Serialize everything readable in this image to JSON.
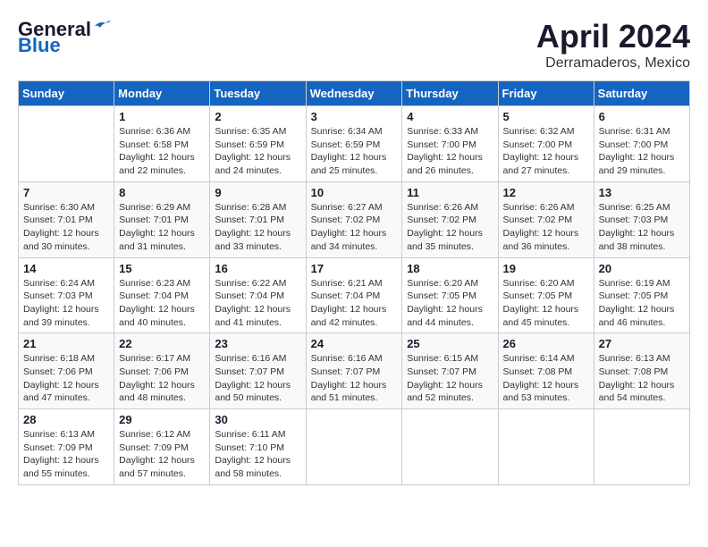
{
  "header": {
    "logo_line1": "General",
    "logo_line2": "Blue",
    "title": "April 2024",
    "subtitle": "Derramaderos, Mexico"
  },
  "calendar": {
    "days_of_week": [
      "Sunday",
      "Monday",
      "Tuesday",
      "Wednesday",
      "Thursday",
      "Friday",
      "Saturday"
    ],
    "weeks": [
      [
        {
          "day": "",
          "info": ""
        },
        {
          "day": "1",
          "info": "Sunrise: 6:36 AM\nSunset: 6:58 PM\nDaylight: 12 hours\nand 22 minutes."
        },
        {
          "day": "2",
          "info": "Sunrise: 6:35 AM\nSunset: 6:59 PM\nDaylight: 12 hours\nand 24 minutes."
        },
        {
          "day": "3",
          "info": "Sunrise: 6:34 AM\nSunset: 6:59 PM\nDaylight: 12 hours\nand 25 minutes."
        },
        {
          "day": "4",
          "info": "Sunrise: 6:33 AM\nSunset: 7:00 PM\nDaylight: 12 hours\nand 26 minutes."
        },
        {
          "day": "5",
          "info": "Sunrise: 6:32 AM\nSunset: 7:00 PM\nDaylight: 12 hours\nand 27 minutes."
        },
        {
          "day": "6",
          "info": "Sunrise: 6:31 AM\nSunset: 7:00 PM\nDaylight: 12 hours\nand 29 minutes."
        }
      ],
      [
        {
          "day": "7",
          "info": "Sunrise: 6:30 AM\nSunset: 7:01 PM\nDaylight: 12 hours\nand 30 minutes."
        },
        {
          "day": "8",
          "info": "Sunrise: 6:29 AM\nSunset: 7:01 PM\nDaylight: 12 hours\nand 31 minutes."
        },
        {
          "day": "9",
          "info": "Sunrise: 6:28 AM\nSunset: 7:01 PM\nDaylight: 12 hours\nand 33 minutes."
        },
        {
          "day": "10",
          "info": "Sunrise: 6:27 AM\nSunset: 7:02 PM\nDaylight: 12 hours\nand 34 minutes."
        },
        {
          "day": "11",
          "info": "Sunrise: 6:26 AM\nSunset: 7:02 PM\nDaylight: 12 hours\nand 35 minutes."
        },
        {
          "day": "12",
          "info": "Sunrise: 6:26 AM\nSunset: 7:02 PM\nDaylight: 12 hours\nand 36 minutes."
        },
        {
          "day": "13",
          "info": "Sunrise: 6:25 AM\nSunset: 7:03 PM\nDaylight: 12 hours\nand 38 minutes."
        }
      ],
      [
        {
          "day": "14",
          "info": "Sunrise: 6:24 AM\nSunset: 7:03 PM\nDaylight: 12 hours\nand 39 minutes."
        },
        {
          "day": "15",
          "info": "Sunrise: 6:23 AM\nSunset: 7:04 PM\nDaylight: 12 hours\nand 40 minutes."
        },
        {
          "day": "16",
          "info": "Sunrise: 6:22 AM\nSunset: 7:04 PM\nDaylight: 12 hours\nand 41 minutes."
        },
        {
          "day": "17",
          "info": "Sunrise: 6:21 AM\nSunset: 7:04 PM\nDaylight: 12 hours\nand 42 minutes."
        },
        {
          "day": "18",
          "info": "Sunrise: 6:20 AM\nSunset: 7:05 PM\nDaylight: 12 hours\nand 44 minutes."
        },
        {
          "day": "19",
          "info": "Sunrise: 6:20 AM\nSunset: 7:05 PM\nDaylight: 12 hours\nand 45 minutes."
        },
        {
          "day": "20",
          "info": "Sunrise: 6:19 AM\nSunset: 7:05 PM\nDaylight: 12 hours\nand 46 minutes."
        }
      ],
      [
        {
          "day": "21",
          "info": "Sunrise: 6:18 AM\nSunset: 7:06 PM\nDaylight: 12 hours\nand 47 minutes."
        },
        {
          "day": "22",
          "info": "Sunrise: 6:17 AM\nSunset: 7:06 PM\nDaylight: 12 hours\nand 48 minutes."
        },
        {
          "day": "23",
          "info": "Sunrise: 6:16 AM\nSunset: 7:07 PM\nDaylight: 12 hours\nand 50 minutes."
        },
        {
          "day": "24",
          "info": "Sunrise: 6:16 AM\nSunset: 7:07 PM\nDaylight: 12 hours\nand 51 minutes."
        },
        {
          "day": "25",
          "info": "Sunrise: 6:15 AM\nSunset: 7:07 PM\nDaylight: 12 hours\nand 52 minutes."
        },
        {
          "day": "26",
          "info": "Sunrise: 6:14 AM\nSunset: 7:08 PM\nDaylight: 12 hours\nand 53 minutes."
        },
        {
          "day": "27",
          "info": "Sunrise: 6:13 AM\nSunset: 7:08 PM\nDaylight: 12 hours\nand 54 minutes."
        }
      ],
      [
        {
          "day": "28",
          "info": "Sunrise: 6:13 AM\nSunset: 7:09 PM\nDaylight: 12 hours\nand 55 minutes."
        },
        {
          "day": "29",
          "info": "Sunrise: 6:12 AM\nSunset: 7:09 PM\nDaylight: 12 hours\nand 57 minutes."
        },
        {
          "day": "30",
          "info": "Sunrise: 6:11 AM\nSunset: 7:10 PM\nDaylight: 12 hours\nand 58 minutes."
        },
        {
          "day": "",
          "info": ""
        },
        {
          "day": "",
          "info": ""
        },
        {
          "day": "",
          "info": ""
        },
        {
          "day": "",
          "info": ""
        }
      ]
    ]
  }
}
